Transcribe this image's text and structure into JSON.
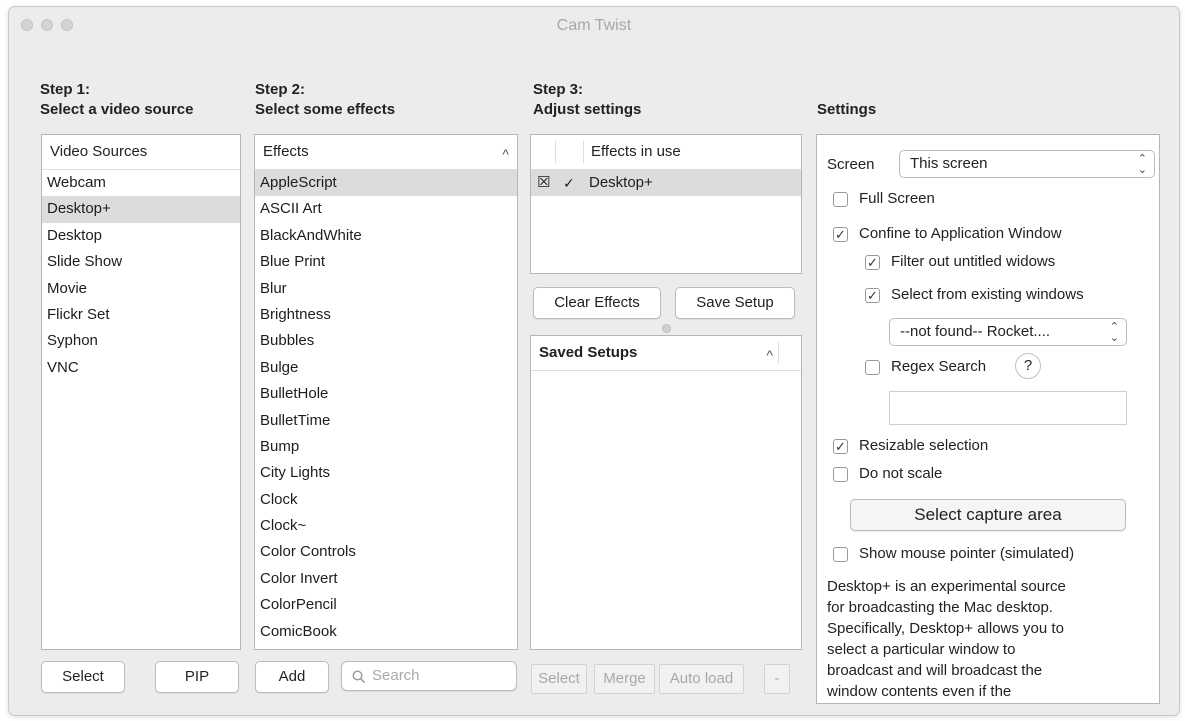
{
  "window": {
    "title": "Cam Twist"
  },
  "step1": {
    "line1": "Step 1:",
    "line2": "Select a video source",
    "header": "Video Sources",
    "items": [
      "Webcam",
      "Desktop+",
      "Desktop",
      "Slide Show",
      "Movie",
      "Flickr Set",
      "Syphon",
      "VNC"
    ],
    "selected": "Desktop+",
    "select_button": "Select",
    "pip_button": "PIP"
  },
  "step2": {
    "line1": "Step 2:",
    "line2": "Select some effects",
    "header": "Effects",
    "sort_icon": "^",
    "items": [
      "AppleScript",
      "ASCII Art",
      "BlackAndWhite",
      "Blue Print",
      "Blur",
      "Brightness",
      "Bubbles",
      "Bulge",
      "BulletHole",
      "BulletTime",
      "Bump",
      "City Lights",
      "Clock",
      "Clock~",
      "Color Controls",
      "Color Invert",
      "ColorPencil",
      "ComicBook"
    ],
    "selected": "AppleScript",
    "add_button": "Add",
    "search_placeholder": "Search"
  },
  "step3": {
    "line1": "Step 3:",
    "line2": "Adjust settings",
    "effects_header": "Effects in use",
    "effect_in_use": {
      "name": "Desktop+",
      "remove_glyph": "☒",
      "enabled_glyph": "✓"
    },
    "clear_button": "Clear Effects",
    "save_button": "Save Setup",
    "saved_header": "Saved Setups",
    "sort_icon": "^",
    "select_button": "Select",
    "merge_button": "Merge",
    "autoload_button": "Auto load",
    "minus_button": "-"
  },
  "settings": {
    "title": "Settings",
    "screen_label": "Screen",
    "screen_value": "This screen",
    "full_screen": "Full Screen",
    "confine": "Confine to Application Window",
    "filter_untitled": "Filter out untitled widows",
    "select_existing": "Select from existing windows",
    "window_value": "--not found-- Rocket....",
    "regex": "Regex Search",
    "help": "?",
    "regex_value": "",
    "resizable": "Resizable selection",
    "no_scale": "Do not scale",
    "capture_button": "Select capture area",
    "show_pointer": "Show mouse pointer (simulated)",
    "description": [
      "Desktop+ is an experimental source",
      "for broadcasting the Mac desktop.",
      "Specifically, Desktop+ allows you to",
      "select a particular window to",
      "broadcast and will broadcast the",
      "window contents even if the"
    ],
    "checked": {
      "full_screen": false,
      "confine": true,
      "filter_untitled": true,
      "select_existing": true,
      "regex": false,
      "resizable": true,
      "no_scale": false,
      "show_pointer": false
    }
  },
  "icons": {
    "check": "✓",
    "popup_caret": "⌃⌄",
    "search": "search-icon"
  }
}
